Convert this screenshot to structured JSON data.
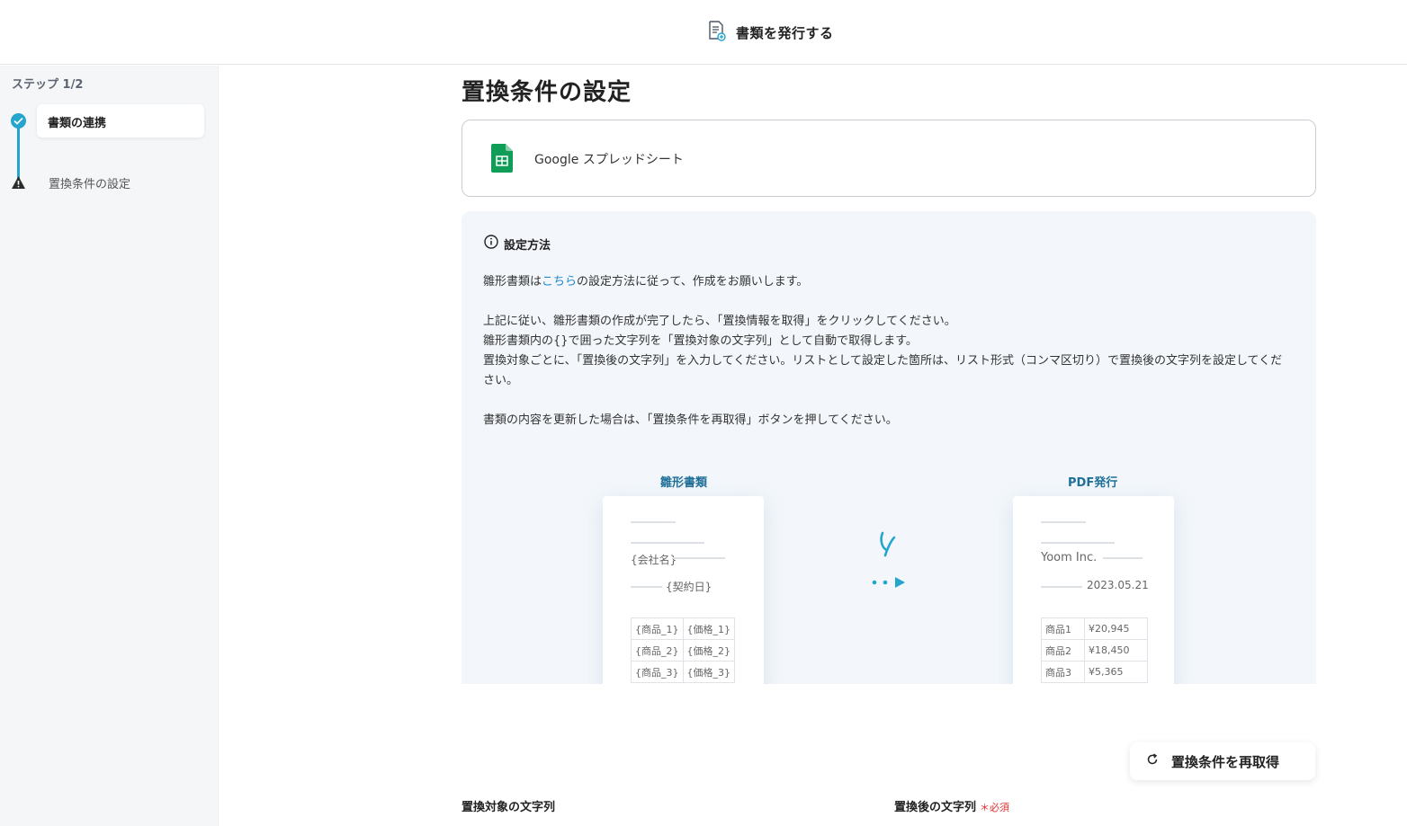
{
  "header": {
    "title": "書類を発行する",
    "icon": "document-issue-icon"
  },
  "sidebar": {
    "step_count": "ステップ 1/2",
    "steps": [
      {
        "label": "書類の連携",
        "status": "complete",
        "icon": "check-circle-icon"
      },
      {
        "label": "置換条件の設定",
        "status": "warning",
        "icon": "warning-icon"
      }
    ]
  },
  "main": {
    "title": "置換条件の設定",
    "service": {
      "name": "Google スプレッドシート",
      "icon": "google-sheets-icon"
    },
    "info": {
      "heading": "設定方法",
      "line1_prefix": "雛形書類は",
      "line1_link": "こちら",
      "line1_suffix": "の設定方法に従って、作成をお願いします。",
      "para2_line1": "上記に従い、雛形書類の作成が完了したら、「置換情報を取得」をクリックしてください。",
      "para2_line2": "雛形書類内の{}で囲った文字列を「置換対象の文字列」として自動で取得します。",
      "para2_line3": "置換対象ごとに、「置換後の文字列」を入力してください。リストとして設定した箇所は、リスト形式（コンマ区切り）で置換後の文字列を設定してくだ",
      "para2_line4": "さい。",
      "para3": "書類の内容を更新した場合は、「置換条件を再取得」ボタンを押してください。"
    },
    "illustration": {
      "template_label": "雛形書類",
      "template_company": "{会社名}",
      "template_date": "{契約日}",
      "template_rows": [
        [
          "{商品_1}",
          "{価格_1}"
        ],
        [
          "{商品_2}",
          "{価格_2}"
        ],
        [
          "{商品_3}",
          "{価格_3}"
        ]
      ],
      "output_label": "PDF発行",
      "output_company": "Yoom Inc.",
      "output_date": "2023.05.21",
      "output_rows": [
        [
          "商品1",
          "¥20,945"
        ],
        [
          "商品2",
          "¥18,450"
        ],
        [
          "商品3",
          "¥5,365"
        ]
      ]
    },
    "refetch_button": "置換条件を再取得",
    "fields": {
      "target_label": "置換対象の文字列",
      "replacement_label": "置換後の文字列",
      "required_mark": "＊必須"
    }
  },
  "colors": {
    "accent": "#23a5cd",
    "link": "#1e86c6",
    "required": "#e03131",
    "sheets_green": "#0f9d58"
  }
}
